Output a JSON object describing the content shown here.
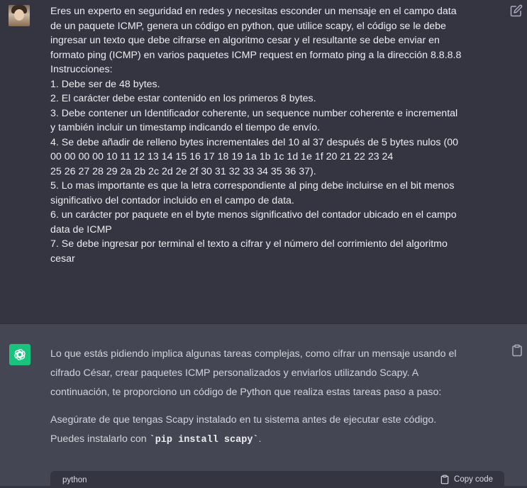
{
  "user_message": {
    "lines": [
      "Eres un experto en seguridad en redes y necesitas esconder un mensaje en el campo data",
      "de un paquete ICMP, genera un código en python, que utilice scapy,  el código se le debe",
      "ingresar un texto que debe cifrarse en algoritmo cesar y el resultante se debe enviar en",
      "formato ping (ICMP) en varios paquetes ICMP request en formato ping a la dirección 8.8.8.8",
      "Instrucciones:",
      "1. Debe ser de 48 bytes.",
      "2. El carácter debe estar contenido en los primeros 8 bytes.",
      "3. Debe contener un Identificador coherente, un sequence number coherente e incremental",
      "y también incluir un timestamp indicando el tiempo de envío.",
      "4. Se debe añadir de relleno bytes incrementales del 10 al 37 después de 5 bytes nulos (00",
      "00 00 00 00 10 11 12 13 14 15 16 17 18 19 1a 1b 1c 1d 1e 1f 20 21 22 23 24",
      "25 26 27 28 29 2a 2b 2c 2d 2e 2f 30 31 32 33 34 35 36 37).",
      "5. Lo mas importante es que la letra correspondiente al ping debe incluirse en el bit menos",
      "significativo del contador incluido en el campo de data.",
      "6. un carácter por paquete en el byte menos significativo del contador ubicado en el campo",
      "data de ICMP",
      "7. Se debe ingresar por terminal el texto a cifrar y el número del corrimiento del algoritmo",
      "cesar"
    ]
  },
  "assistant_message": {
    "paragraph1": [
      "Lo que estás pidiendo implica algunas tareas complejas, como cifrar un mensaje usando el",
      "cifrado César, crear paquetes ICMP personalizados y enviarlos utilizando Scapy. A",
      "continuación, te proporciono un código de Python que realiza estas tareas paso a paso:"
    ],
    "paragraph2_line1": "Asegúrate de que tengas Scapy instalado en tu sistema antes de ejecutar este código.",
    "paragraph2_prefix": "Puedes instalarlo con ",
    "inline_code": "`pip install scapy`",
    "paragraph2_suffix": "."
  },
  "code_block": {
    "language": "python",
    "copy_label": "Copy code"
  },
  "icons": {
    "edit": "edit-icon",
    "copy": "clipboard-icon",
    "assistant_avatar": "openai-logo-icon"
  },
  "colors": {
    "user_bg": "#343541",
    "assistant_bg": "#444654",
    "assistant_avatar_bg": "#19c37d"
  }
}
